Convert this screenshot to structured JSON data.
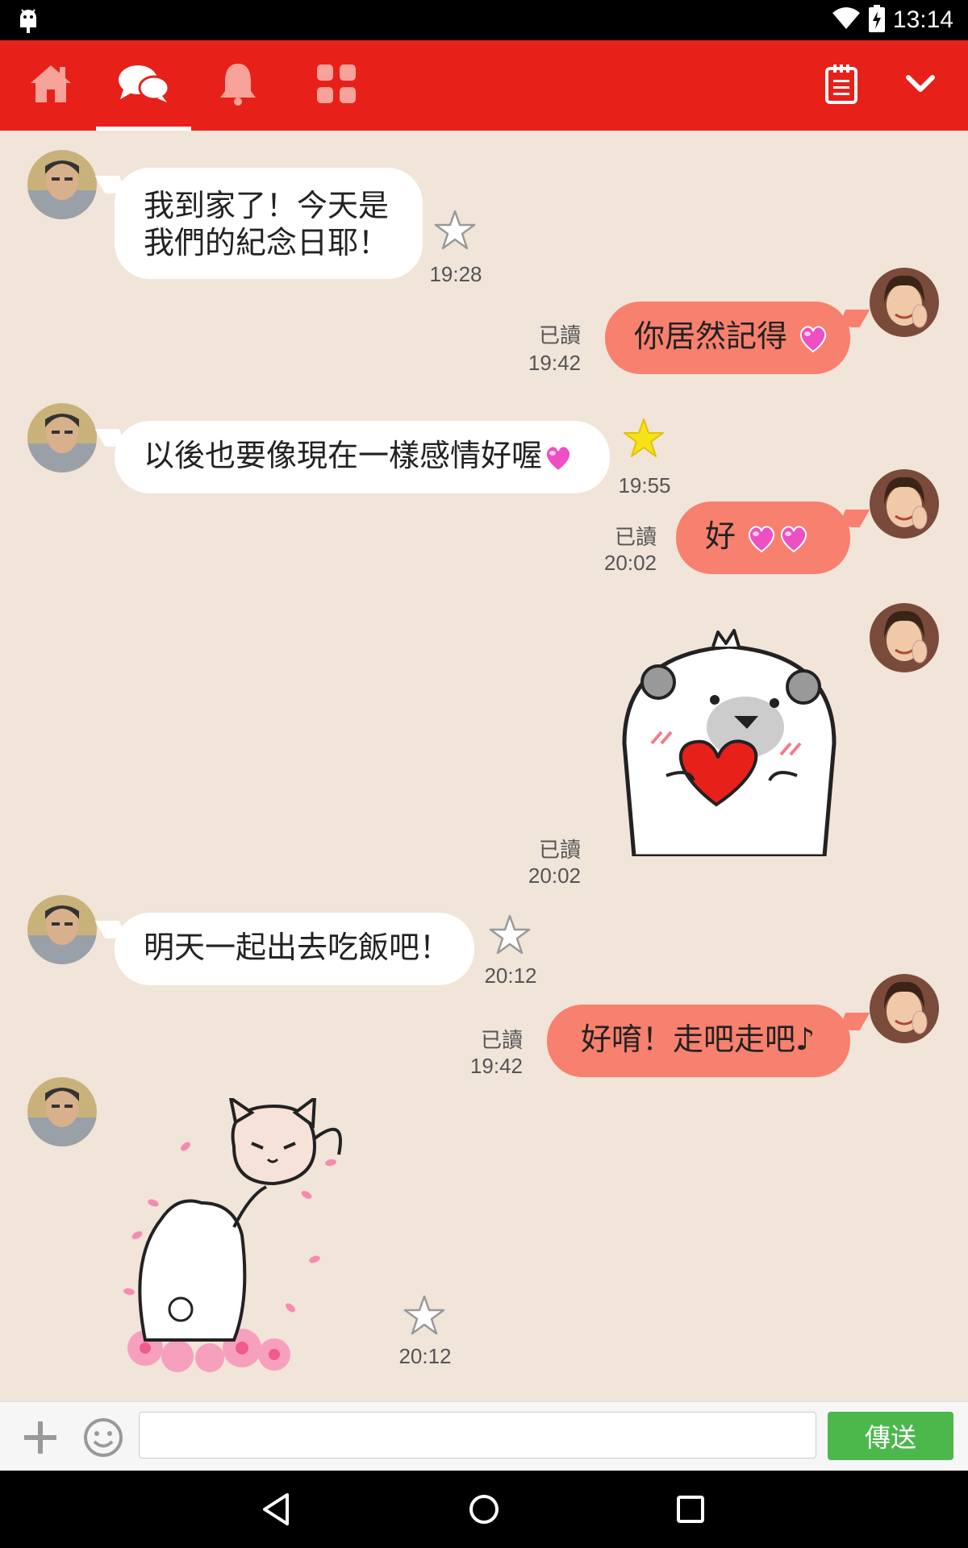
{
  "status_bar": {
    "time": "13:14"
  },
  "header": {
    "tabs": [
      {
        "icon": "home-icon"
      },
      {
        "icon": "chat-icon",
        "active": true
      },
      {
        "icon": "bell-icon"
      },
      {
        "icon": "apps-grid-icon"
      }
    ],
    "right_icons": [
      "notes-icon",
      "chevron-down-icon"
    ]
  },
  "messages": [
    {
      "from": "them",
      "text_line1": "我到家了！今天是",
      "text_line2": "我們的紀念日耶！",
      "time": "19:28",
      "starred": false
    },
    {
      "from": "me",
      "text": "你居然記得",
      "read": "已讀",
      "time": "19:42",
      "emoji": "heart"
    },
    {
      "from": "them",
      "text": "以後也要像現在一樣感情好喔",
      "time": "19:55",
      "starred": true,
      "emoji": "heart"
    },
    {
      "from": "me",
      "text": "好",
      "read": "已讀",
      "time": "20:02",
      "emoji": "two-hearts"
    },
    {
      "from": "me",
      "sticker": "bear-with-heart",
      "read": "已讀",
      "time": "20:02"
    },
    {
      "from": "them",
      "text": "明天一起出去吃飯吧！",
      "time": "20:12",
      "starred": false
    },
    {
      "from": "me",
      "text": "好唷！走吧走吧♪",
      "read": "已讀",
      "time": "19:42"
    },
    {
      "from": "them",
      "sticker": "bear-and-cat-flowers",
      "time": "20:12",
      "starred": false
    }
  ],
  "composer": {
    "placeholder": "",
    "send_label": "傳送"
  },
  "colors": {
    "brand_red": "#e8201a",
    "bubble_out": "#f8806e",
    "chat_bg": "#f1e4d9",
    "send_green": "#4cb84c"
  }
}
